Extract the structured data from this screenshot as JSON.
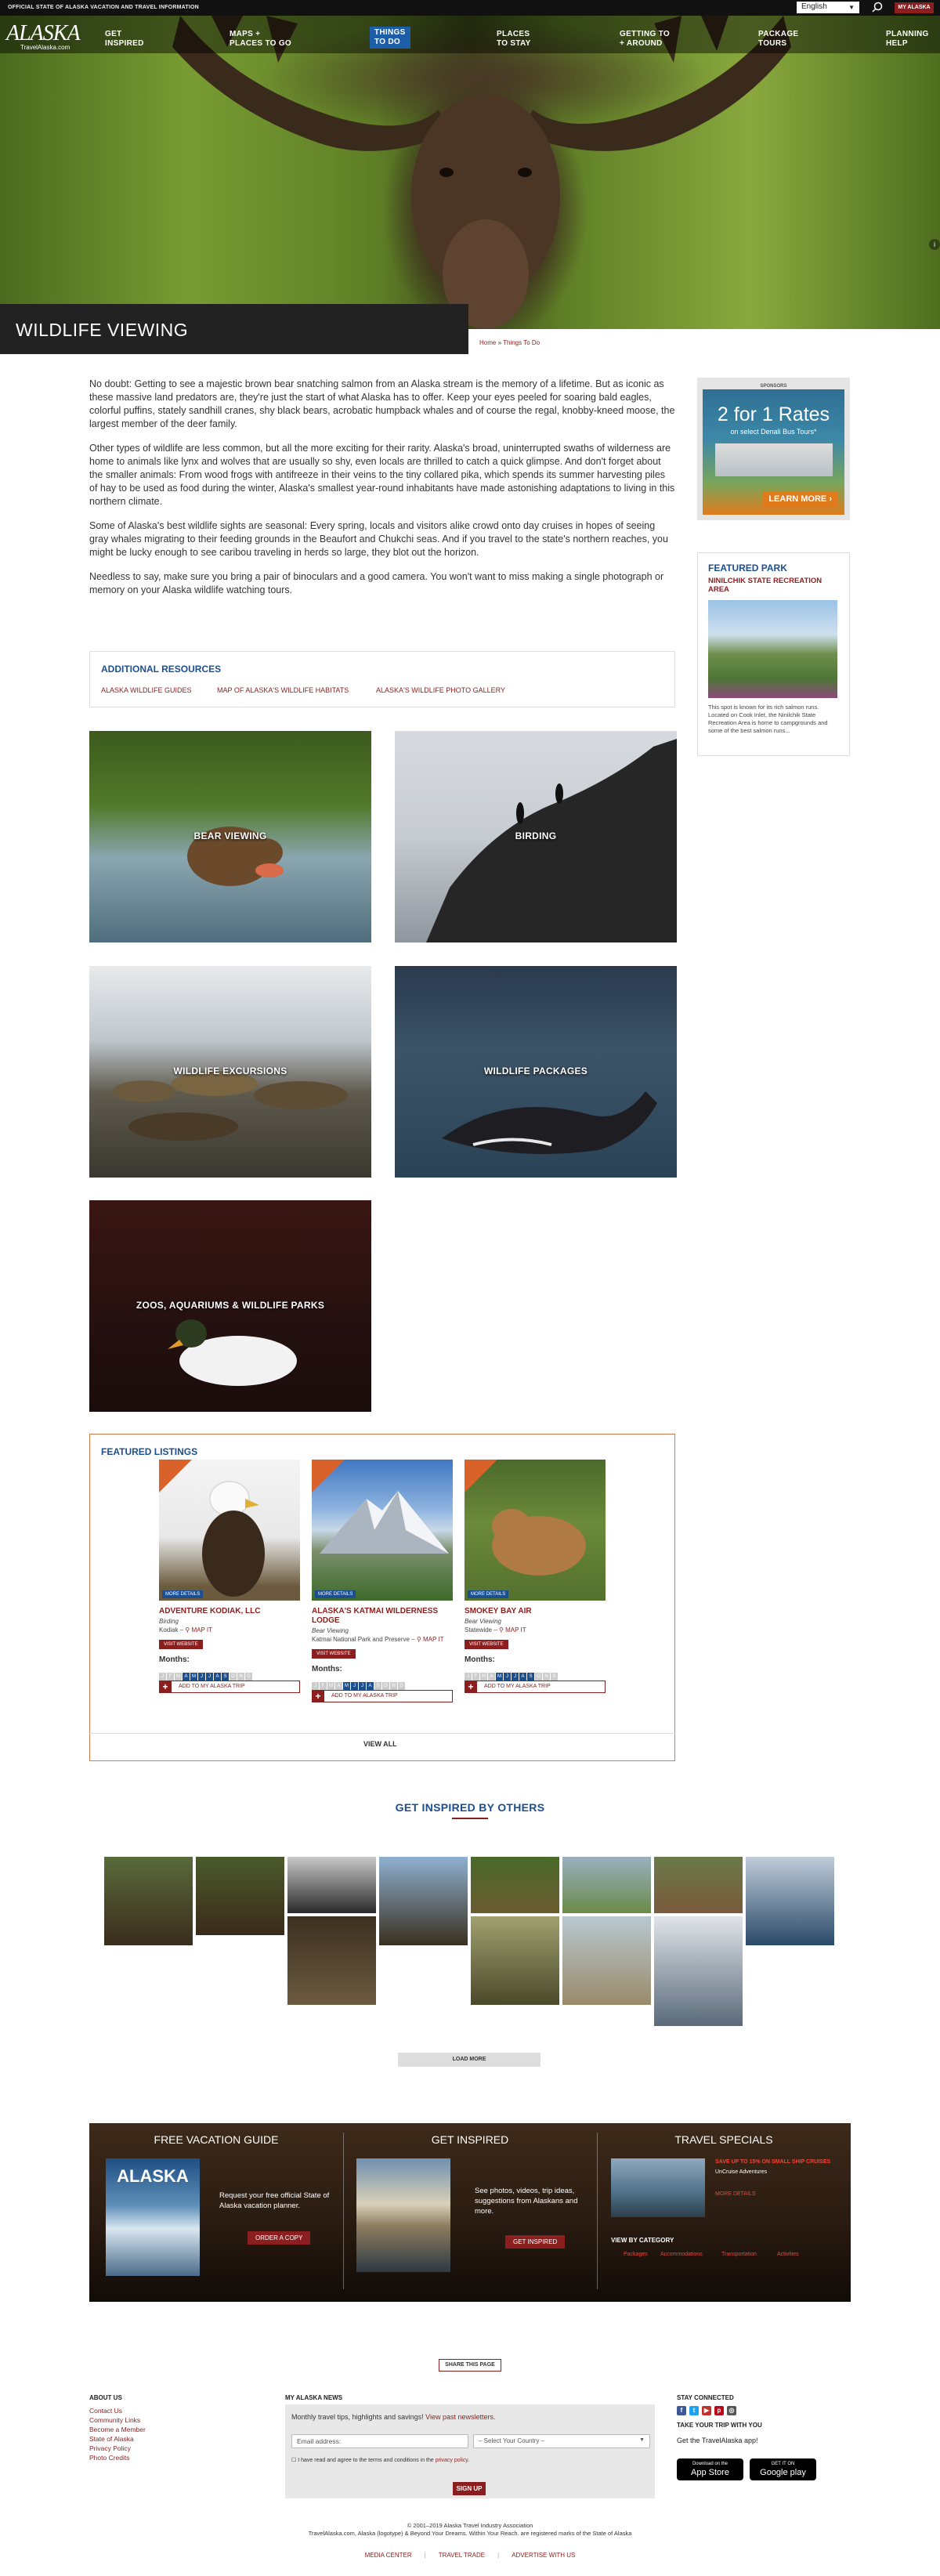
{
  "topbar": {
    "title": "OFFICIAL STATE OF ALASKA VACATION AND TRAVEL INFORMATION",
    "language": "English",
    "my_alaska": "MY ALASKA"
  },
  "logo": {
    "text": "ALASKA",
    "site": "TravelAlaska.com"
  },
  "nav": [
    {
      "line1": "GET",
      "line2": "INSPIRED"
    },
    {
      "line1": "MAPS +",
      "line2": "PLACES TO GO"
    },
    {
      "line1": "THINGS",
      "line2": "TO DO"
    },
    {
      "line1": "PLACES",
      "line2": "TO STAY"
    },
    {
      "line1": "GETTING TO",
      "line2": "+ AROUND"
    },
    {
      "line1": "PACKAGE",
      "line2": "TOURS"
    },
    {
      "line1": "PLANNING",
      "line2": "HELP"
    }
  ],
  "page": {
    "title": "WILDLIFE VIEWING",
    "breadcrumb_home": "Home",
    "breadcrumb_sep": "»",
    "breadcrumb_current": "Things To Do"
  },
  "intro": [
    "No doubt: Getting to see a majestic brown bear snatching salmon from an Alaska stream is the memory of a lifetime. But as iconic as these massive land predators are, they're just the start of what Alaska has to offer. Keep your eyes peeled for soaring bald eagles, colorful puffins, stately sandhill cranes, shy black bears, acrobatic humpback whales and of course the regal, knobby-kneed moose, the largest member of the deer family.",
    "Other types of wildlife are less common, but all the more exciting for their rarity. Alaska's broad, uninterrupted swaths of wilderness are home to animals like lynx and wolves that are usually so shy, even locals are thrilled to catch a quick glimpse. And don't forget about the smaller animals: From wood frogs with antifreeze in their veins to the tiny collared pika, which spends its summer harvesting piles of hay to be used as food during the winter, Alaska's smallest year-round inhabitants have made astonishing adaptations to living in this northern climate.",
    "Some of Alaska's best wildlife sights are seasonal: Every spring, locals and visitors alike crowd onto day cruises in hopes of seeing gray whales migrating to their feeding grounds in the Beaufort and Chukchi seas. And if you travel to the state's northern reaches, you might be lucky enough to see caribou traveling in herds so large, they blot out the horizon.",
    "Needless to say, make sure you bring a pair of binoculars and a good camera. You won't want to miss making a single photograph or memory on your Alaska wildlife watching tours."
  ],
  "sponsor": {
    "label": "SPONSORS",
    "ad_title": "2 for 1 Rates",
    "ad_sub": "on select Denali Bus Tours*",
    "ad_cta": "LEARN MORE ›"
  },
  "featured_park": {
    "heading": "FEATURED PARK",
    "name": "NINILCHIK STATE RECREATION AREA",
    "desc": "This spot is known for its rich salmon runs. Located on Cook Inlet, the Ninilchik State Recreation Area is home to campgrounds and some of the best salmon runs..."
  },
  "resources": {
    "heading": "ADDITIONAL RESOURCES",
    "links": [
      "ALASKA WILDLIFE GUIDES",
      "MAP OF ALASKA'S WILDLIFE HABITATS",
      "ALASKA'S WILDLIFE PHOTO GALLERY"
    ]
  },
  "tiles": [
    "BEAR VIEWING",
    "BIRDING",
    "WILDLIFE EXCURSIONS",
    "WILDLIFE PACKAGES",
    "ZOOS, AQUARIUMS & WILDLIFE PARKS"
  ],
  "featured": {
    "heading": "FEATURED LISTINGS",
    "more": "MORE DETAILS",
    "visit": "VISIT WEBSITE",
    "months_label": "Months:",
    "add": "ADD TO MY ALASKA TRIP",
    "map": "MAP IT",
    "month_letters": [
      "J",
      "F",
      "M",
      "A",
      "M",
      "J",
      "J",
      "A",
      "S",
      "O",
      "N",
      "D"
    ],
    "view_all": "VIEW ALL",
    "listings": [
      {
        "name": "ADVENTURE KODIAK, LLC",
        "category": "Birding",
        "location": "Kodiak –",
        "months_on": [
          4,
          5,
          6,
          7,
          8,
          9
        ]
      },
      {
        "name": "ALASKA'S KATMAI WILDERNESS LODGE",
        "category": "Bear Viewing",
        "location": "Katmai National Park and Preserve –",
        "months_on": [
          5,
          6,
          7,
          8
        ]
      },
      {
        "name": "SMOKEY BAY AIR",
        "category": "Bear Viewing",
        "location": "Statewide –",
        "months_on": [
          5,
          6,
          7,
          8,
          9
        ]
      }
    ]
  },
  "inspired": {
    "heading": "GET INSPIRED BY OTHERS",
    "load_more": "LOAD MORE"
  },
  "promo": {
    "guide_head": "FREE VACATION GUIDE",
    "guide_cover": "ALASKA",
    "guide_text": "Request your free official State of Alaska vacation planner.",
    "guide_btn": "ORDER A COPY",
    "insp_head": "GET INSPIRED",
    "insp_text": "See photos, videos, trip ideas, suggestions from Alaskans and more.",
    "insp_btn": "GET INSPIRED",
    "ts_head": "TRAVEL SPECIALS",
    "ts_offer": "SAVE UP TO 15% ON SMALL SHIP CRUISES",
    "ts_vendor": "UnCruise Adventures",
    "ts_more": "MORE DETAILS",
    "by_cat": "VIEW BY CATEGORY",
    "cats": [
      "Packages",
      "Accommodations",
      "Transportation",
      "Activities"
    ]
  },
  "share": "SHARE THIS PAGE",
  "footer": {
    "about_head": "ABOUT US",
    "about_links": [
      "Contact Us",
      "Community Links",
      "Become a Member",
      "State of Alaska",
      "Privacy Policy",
      "Photo Credits"
    ],
    "news_head": "MY ALASKA NEWS",
    "news_text": "Monthly travel tips, highlights and savings!",
    "news_link": "View past newsletters.",
    "email_ph": "Email address:",
    "country": "– Select Your Country –",
    "agree": "I have read and agree to the terms and conditions in the",
    "agree_link": "privacy policy.",
    "signup": "SIGN UP",
    "stay_head": "STAY CONNECTED",
    "take": "TAKE YOUR TRIP WITH YOU",
    "get_app": "Get the TravelAlaska app!",
    "appstore_small": "Download on the",
    "appstore": "App Store",
    "gplay_small": "GET IT ON",
    "gplay": "Google play",
    "copy1": "© 2001–2019 Alaska Travel Industry Association",
    "copy2": "TravelAlaska.com, Alaska (logotype) & Beyond Your Dreams. Within Your Reach. are registered marks of the State of Alaska",
    "bottom": [
      "MEDIA CENTER",
      "TRAVEL TRADE",
      "ADVERTISE WITH US"
    ]
  },
  "colors": {
    "brand_red": "#8b1e1e",
    "brand_blue": "#1c4f8f",
    "nav_active": "#1c5fa8"
  }
}
